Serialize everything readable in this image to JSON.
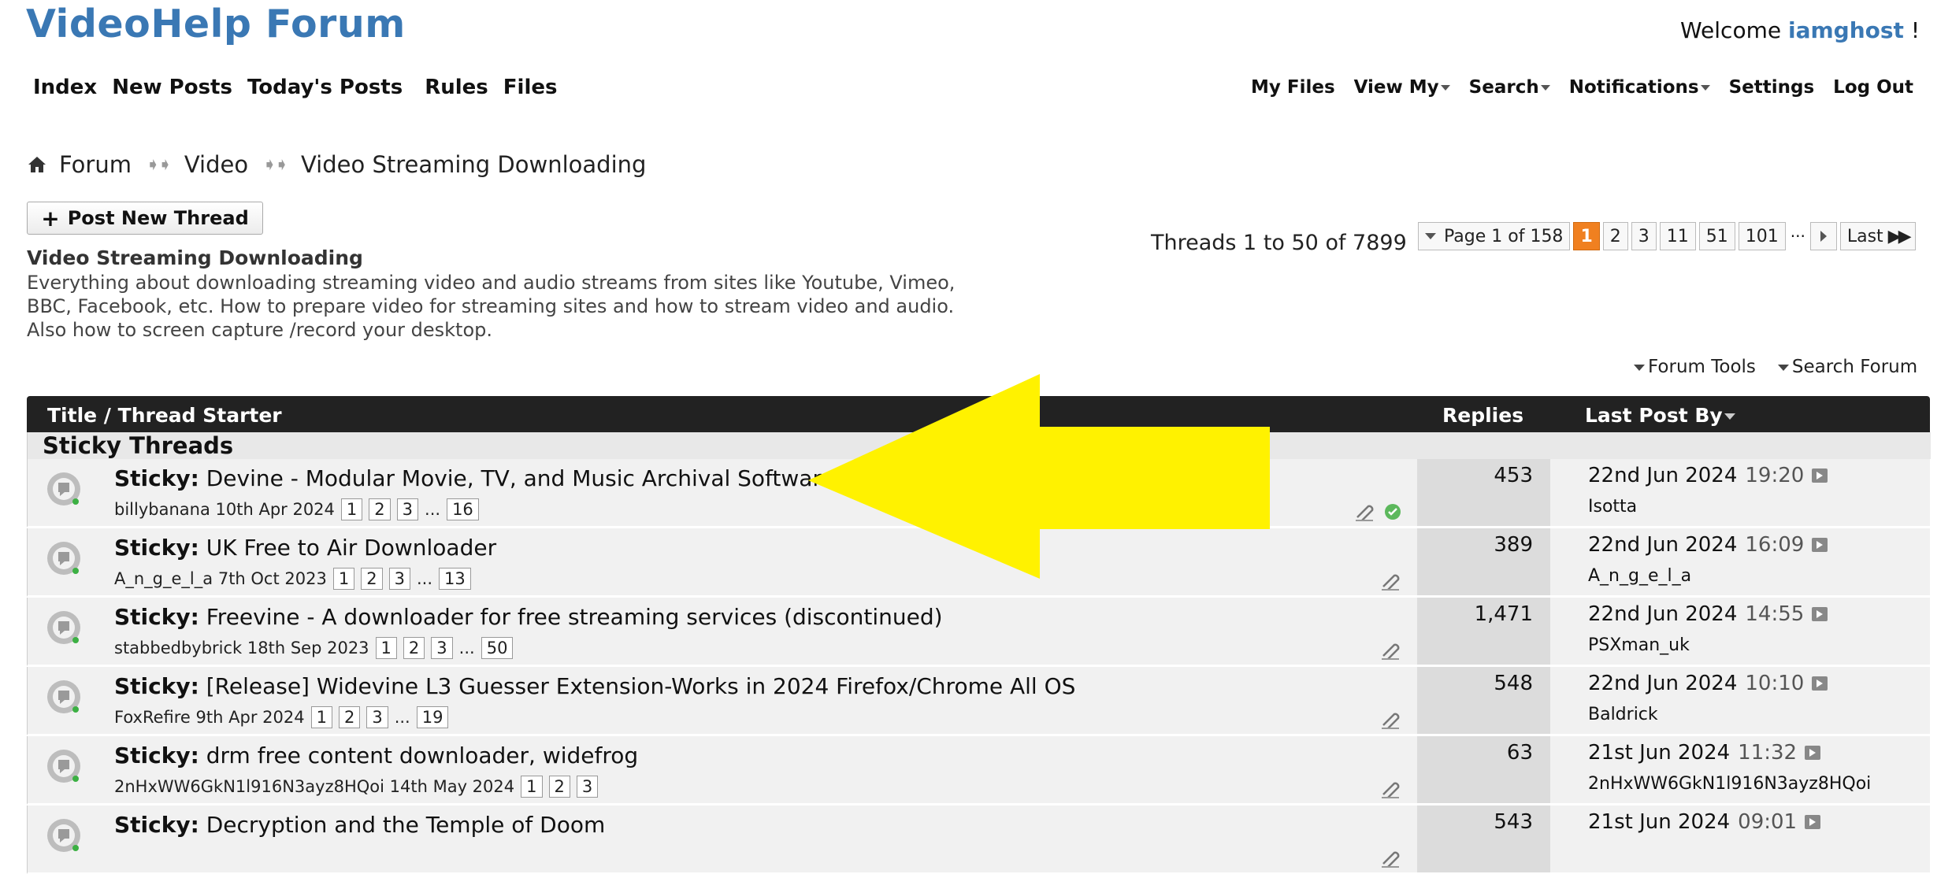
{
  "header": {
    "site_title": "VideoHelp Forum",
    "welcome_text": "Welcome",
    "username": "iamghost",
    "welcome_suffix": "!"
  },
  "main_nav": [
    "Index",
    "New Posts",
    "Today's Posts",
    "Rules",
    "Files"
  ],
  "right_nav": [
    {
      "label": "My Files",
      "dropdown": false
    },
    {
      "label": "View My",
      "dropdown": true
    },
    {
      "label": "Search",
      "dropdown": true
    },
    {
      "label": "Notifications",
      "dropdown": true
    },
    {
      "label": "Settings",
      "dropdown": false
    },
    {
      "label": "Log Out",
      "dropdown": false
    }
  ],
  "breadcrumb": {
    "items": [
      "Forum",
      "Video",
      "Video Streaming Downloading"
    ],
    "home_icon": "home-icon"
  },
  "post_button": {
    "label": "Post New Thread"
  },
  "forum": {
    "title": "Video Streaming Downloading",
    "description": "Everything about downloading streaming video and audio streams from sites like Youtube, Vimeo, BBC, Facebook, etc. How to prepare video for streaming sites and how to stream video and audio. Also how to screen capture /record your desktop."
  },
  "pagination": {
    "threads_text": "Threads 1 to 50 of 7899",
    "page_label": "Page 1 of 158",
    "pages": [
      "1",
      "2",
      "3",
      "11",
      "51",
      "101"
    ],
    "current": "1",
    "ellipsis": "...",
    "last_label": "Last"
  },
  "tools": {
    "forum_tools": "Forum Tools",
    "search_forum": "Search Forum"
  },
  "table": {
    "col_title": "Title / Thread Starter",
    "col_replies": "Replies",
    "col_last": "Last Post By",
    "section": "Sticky Threads"
  },
  "threads": [
    {
      "prefix": "Sticky:",
      "title": "Devine - Modular Movie, TV, and Music Archival Software",
      "starter": "billybanana",
      "date": "10th Apr 2024",
      "pages": [
        "1",
        "2",
        "3"
      ],
      "last_page": "16",
      "replies": "453",
      "last_date": "22nd Jun 2024",
      "last_time": "19:20",
      "last_user": "Isotta",
      "has_check": true
    },
    {
      "prefix": "Sticky:",
      "title": "UK Free to Air Downloader",
      "starter": "A_n_g_e_l_a",
      "date": "7th Oct 2023",
      "pages": [
        "1",
        "2",
        "3"
      ],
      "last_page": "13",
      "replies": "389",
      "last_date": "22nd Jun 2024",
      "last_time": "16:09",
      "last_user": "A_n_g_e_l_a",
      "has_check": false
    },
    {
      "prefix": "Sticky:",
      "title": "Freevine - A downloader for free streaming services (discontinued)",
      "starter": "stabbedbybrick",
      "date": "18th Sep 2023",
      "pages": [
        "1",
        "2",
        "3"
      ],
      "last_page": "50",
      "replies": "1,471",
      "last_date": "22nd Jun 2024",
      "last_time": "14:55",
      "last_user": "PSXman_uk",
      "has_check": false
    },
    {
      "prefix": "Sticky:",
      "title": "[Release] Widevine L3 Guesser Extension-Works in 2024 Firefox/Chrome All OS",
      "starter": "FoxRefire",
      "date": "9th Apr 2024",
      "pages": [
        "1",
        "2",
        "3"
      ],
      "last_page": "19",
      "replies": "548",
      "last_date": "22nd Jun 2024",
      "last_time": "10:10",
      "last_user": "Baldrick",
      "has_check": false
    },
    {
      "prefix": "Sticky:",
      "title": "drm free content downloader, widefrog",
      "starter": "2nHxWW6GkN1l916N3ayz8HQoi",
      "date": "14th May 2024",
      "pages": [
        "1",
        "2",
        "3"
      ],
      "last_page": "",
      "replies": "63",
      "last_date": "21st Jun 2024",
      "last_time": "11:32",
      "last_user": "2nHxWW6GkN1l916N3ayz8HQoi",
      "has_check": false
    },
    {
      "prefix": "Sticky:",
      "title": "Decryption and the Temple of Doom",
      "starter": "",
      "date": "",
      "pages": [],
      "last_page": "",
      "replies": "543",
      "last_date": "21st Jun 2024",
      "last_time": "09:01",
      "last_user": "",
      "has_check": false
    }
  ],
  "colors": {
    "brand": "#3a78b4",
    "header_bg": "#222222",
    "current_page": "#f08020",
    "arrow": "#fff200"
  }
}
